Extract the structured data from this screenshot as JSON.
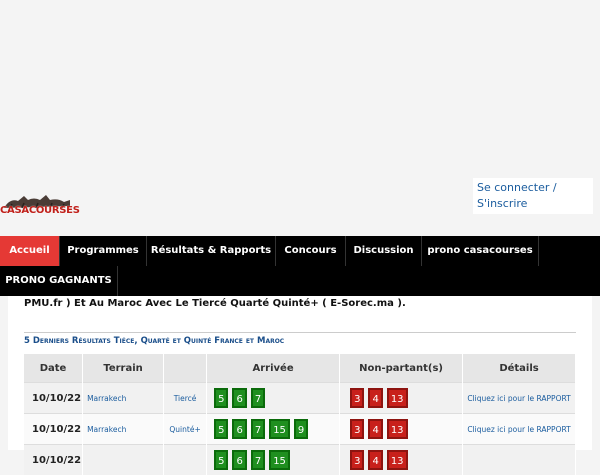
{
  "header": {
    "logo_text": "CASACOURSES",
    "login_link": "Se connecter /",
    "register_link": "S'inscrire"
  },
  "nav": {
    "items": [
      "Accueil",
      "Programmes",
      "Résultats & Rapports",
      "Concours",
      "Discussion",
      "prono casacourses",
      "PRONO GAGNANTS"
    ],
    "active_index": 0
  },
  "content": {
    "intro": "PMU.fr ) Et Au Maroc Avec Le Tiercé Quarté Quinté+ ( E-Sorec.ma ).",
    "section_title": "5 Derniers Résultats Tiéce, Quarté et Quinté France et Maroc",
    "table": {
      "headers": [
        "Date",
        "Terrain",
        "",
        "Arrivée",
        "Non-partant(s)",
        "Détails"
      ],
      "rows": [
        {
          "date": "10/10/22",
          "terrain": "Marrakech",
          "type": "Tiercé",
          "arrivee": [
            "5",
            "6",
            "7"
          ],
          "non_partants": [
            "3",
            "4",
            "13"
          ],
          "details": "Cliquez ici pour le RAPPORT"
        },
        {
          "date": "10/10/22",
          "terrain": "Marrakech",
          "type": "Quinté+",
          "arrivee": [
            "5",
            "6",
            "7",
            "15",
            "9"
          ],
          "non_partants": [
            "3",
            "4",
            "13"
          ],
          "details": "Cliquez ici pour le RAPPORT"
        },
        {
          "date": "10/10/22",
          "terrain": "",
          "type": "",
          "arrivee": [
            "5",
            "6",
            "7",
            "15"
          ],
          "non_partants": [
            "3",
            "4",
            "13"
          ],
          "details": ""
        }
      ]
    }
  },
  "colors": {
    "nav_active": "#e53935",
    "arrivee_ball": "#1f8f1f",
    "non_partant_ball": "#c8201b",
    "link": "#1a5c9e"
  }
}
